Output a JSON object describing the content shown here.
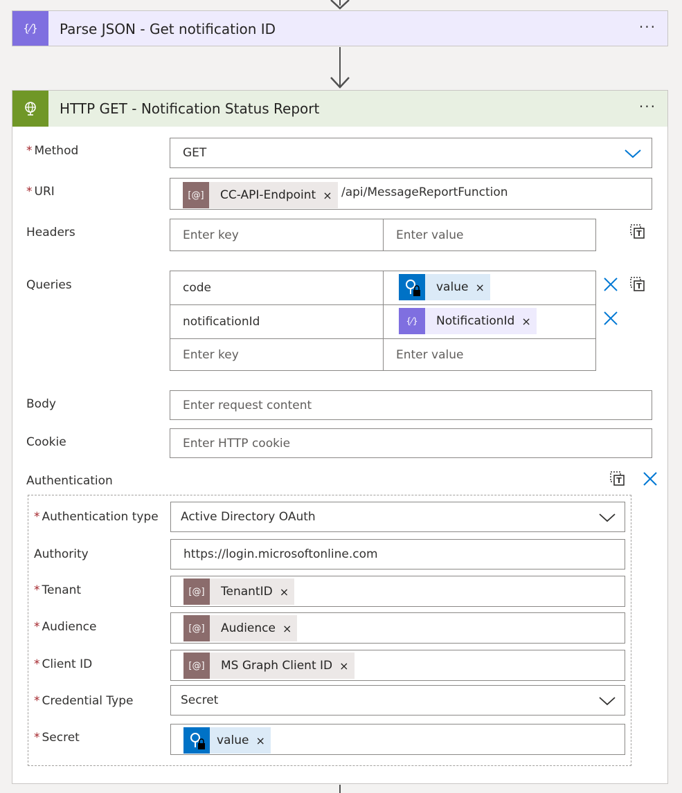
{
  "parse_json": {
    "title": "Parse JSON - Get notification ID",
    "more": "···"
  },
  "http_get": {
    "title": "HTTP GET - Notification Status Report",
    "more": "···",
    "method": {
      "label": "Method",
      "value": "GET"
    },
    "uri": {
      "label": "URI",
      "token": "CC-API-Endpoint",
      "suffix": "/api/MessageReportFunction"
    },
    "headers": {
      "label": "Headers",
      "key_placeholder": "Enter key",
      "value_placeholder": "Enter value"
    },
    "queries": {
      "label": "Queries",
      "rows": [
        {
          "key": "code",
          "value_token": "value"
        },
        {
          "key": "notificationId",
          "value_token": "NotificationId"
        }
      ],
      "key_placeholder": "Enter key",
      "value_placeholder": "Enter value"
    },
    "body": {
      "label": "Body",
      "placeholder": "Enter request content"
    },
    "cookie": {
      "label": "Cookie",
      "placeholder": "Enter HTTP cookie"
    },
    "authentication": {
      "label": "Authentication",
      "type": {
        "label": "Authentication type",
        "value": "Active Directory OAuth"
      },
      "authority": {
        "label": "Authority",
        "value": "https://login.microsoftonline.com"
      },
      "tenant": {
        "label": "Tenant",
        "token": "TenantID"
      },
      "audience": {
        "label": "Audience",
        "token": "Audience"
      },
      "client_id": {
        "label": "Client ID",
        "token": "MS Graph Client ID"
      },
      "credential_type": {
        "label": "Credential Type",
        "value": "Secret"
      },
      "secret": {
        "label": "Secret",
        "token": "value"
      }
    }
  },
  "token_close": "×",
  "required_mark": "*",
  "colors": {
    "parse_accent": "#7f6fe0",
    "http_accent": "#709727",
    "link_blue": "#0078d4",
    "required_red": "#a4262c"
  }
}
